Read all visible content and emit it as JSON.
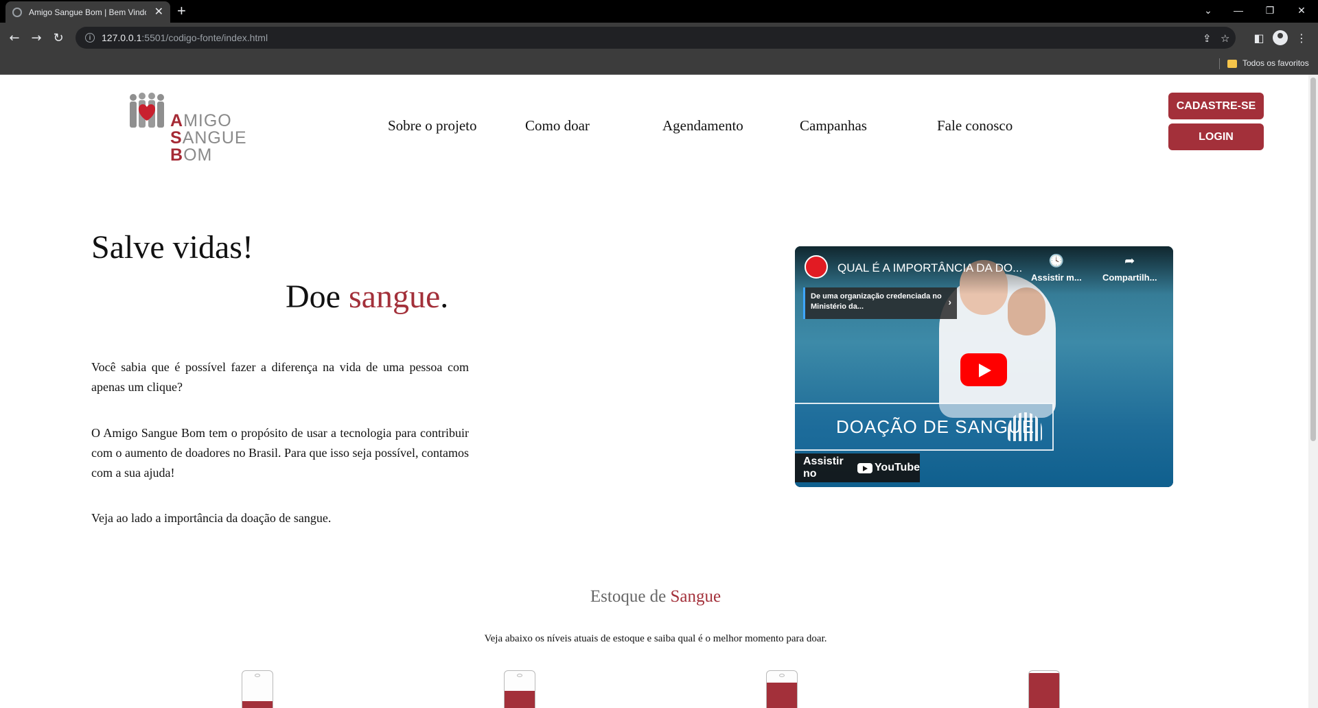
{
  "browser": {
    "tab_title": "Amigo Sangue Bom | Bem Vindo",
    "new_tab": "+",
    "url_host": "127.0.0.1",
    "url_path": ":5501/codigo-fonte/index.html",
    "bookmark_label": "Todos os favoritos"
  },
  "logo": {
    "line1_initial": "A",
    "line1_rest": "MIGO",
    "line2_initial": "S",
    "line2_rest": "ANGUE",
    "line3_initial": "B",
    "line3_rest": "OM"
  },
  "nav": {
    "items": [
      "Sobre o projeto",
      "Como doar",
      "Agendamento",
      "Campanhas",
      "Fale conosco"
    ]
  },
  "actions": {
    "signup": "CADASTRE-SE",
    "login": "LOGIN"
  },
  "hero": {
    "title": "Salve vidas!",
    "sub_prefix": "Doe ",
    "sub_accent": "sangue",
    "sub_suffix": ".",
    "paragraphs": [
      "Você sabia que é possível fazer a diferença na vida de uma pessoa com apenas um clique?",
      "O Amigo Sangue Bom tem o propósito de usar a tecnologia para contribuir com o aumento de doadores no Brasil. Para que isso seja possível, contamos com a sua ajuda!",
      "Veja ao lado a importância da doação de sangue."
    ]
  },
  "video": {
    "title": "QUAL É A IMPORTÂNCIA DA DO...",
    "watch_later": "Assistir m...",
    "share": "Compartilh...",
    "info_badge": "De uma organização credenciada no Ministério da...",
    "banner": "DOAÇÃO DE SANGUE",
    "watch_on": "Assistir no",
    "youtube": "YouTube"
  },
  "stock": {
    "title_prefix": "Estoque de ",
    "title_accent": "Sangue",
    "subtitle": "Veja abaixo os níveis atuais de estoque e saiba qual é o melhor momento para doar.",
    "levels": [
      0.25,
      0.5,
      0.7,
      0.95
    ]
  },
  "colors": {
    "brand": "#a3303a",
    "accent_text": "#a3303a"
  }
}
